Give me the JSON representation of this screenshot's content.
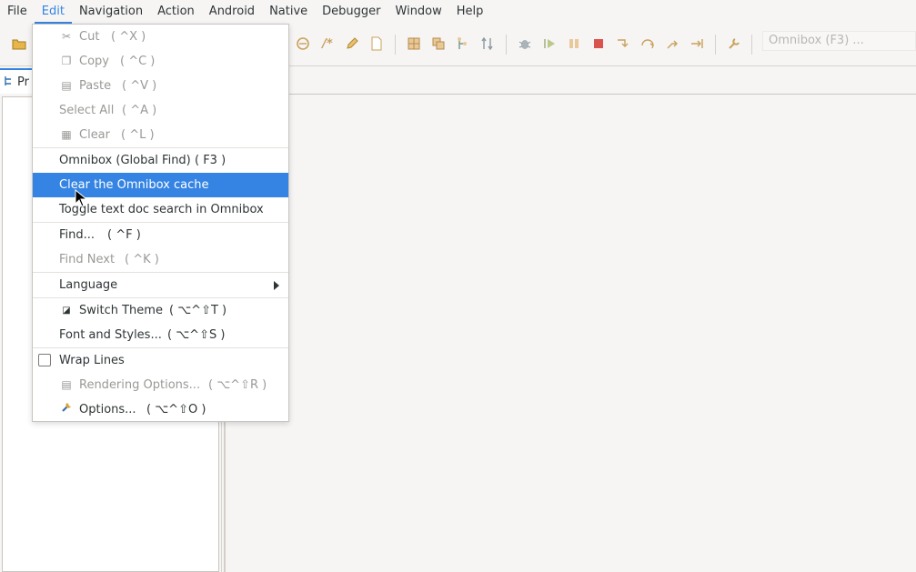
{
  "menubar": {
    "items": [
      "File",
      "Edit",
      "Navigation",
      "Action",
      "Android",
      "Native",
      "Debugger",
      "Window",
      "Help"
    ],
    "active": "Edit"
  },
  "toolbar": {
    "omnibox_placeholder": "Omnibox (F3) ..."
  },
  "left_panel": {
    "tab_label": "Pr"
  },
  "edit_menu": {
    "cut": {
      "label": "Cut",
      "shortcut": "( ^X )"
    },
    "copy": {
      "label": "Copy",
      "shortcut": "( ^C )"
    },
    "paste": {
      "label": "Paste",
      "shortcut": "( ^V )"
    },
    "select_all": {
      "label": "Select All",
      "shortcut": "( ^A )"
    },
    "clear": {
      "label": "Clear",
      "shortcut": "( ^L )"
    },
    "omnibox_find": {
      "label": "Omnibox (Global Find)",
      "shortcut": "( F3 )"
    },
    "clear_omnibox_cache": {
      "label": "Clear the Omnibox cache"
    },
    "toggle_text_doc": {
      "label": "Toggle text doc search in Omnibox"
    },
    "find": {
      "label": "Find...",
      "shortcut": "( ^F )"
    },
    "find_next": {
      "label": "Find Next",
      "shortcut": "( ^K )"
    },
    "language": {
      "label": "Language"
    },
    "switch_theme": {
      "label": "Switch Theme",
      "shortcut": "( ⌥^⇧T )"
    },
    "font_styles": {
      "label": "Font and Styles...",
      "shortcut": "( ⌥^⇧S )"
    },
    "wrap_lines": {
      "label": "Wrap Lines",
      "checked": false
    },
    "rendering_options": {
      "label": "Rendering Options...",
      "shortcut": "( ⌥^⇧R )"
    },
    "options": {
      "label": "Options...",
      "shortcut": "( ⌥^⇧O )"
    }
  },
  "colors": {
    "accent": "#3584e4",
    "disabled_text": "#9a9996",
    "menu_bg": "#ffffff",
    "window_bg": "#f6f5f4"
  }
}
